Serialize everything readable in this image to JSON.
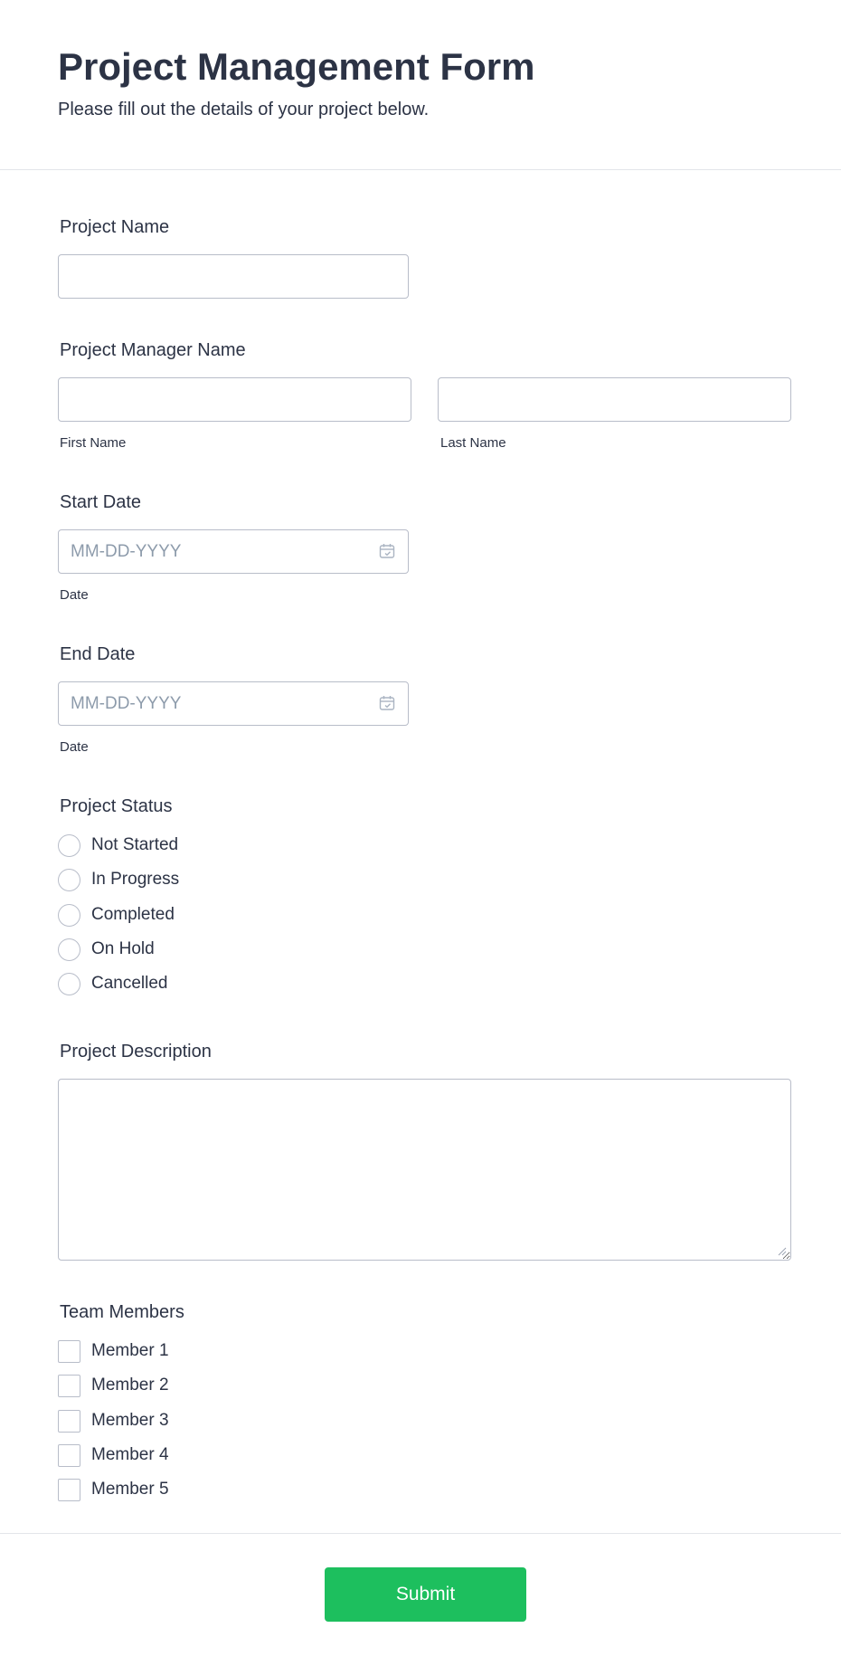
{
  "form": {
    "title": "Project Management Form",
    "subtitle": "Please fill out the details of your project below."
  },
  "project_name": {
    "label": "Project Name",
    "value": ""
  },
  "project_manager": {
    "label": "Project Manager Name",
    "first_name": {
      "value": "",
      "sublabel": "First Name"
    },
    "last_name": {
      "value": "",
      "sublabel": "Last Name"
    }
  },
  "start_date": {
    "label": "Start Date",
    "placeholder": "MM-DD-YYYY",
    "sublabel": "Date",
    "icon": "calendar-icon"
  },
  "end_date": {
    "label": "End Date",
    "placeholder": "MM-DD-YYYY",
    "sublabel": "Date",
    "icon": "calendar-icon"
  },
  "project_status": {
    "label": "Project Status",
    "options": [
      "Not Started",
      "In Progress",
      "Completed",
      "On Hold",
      "Cancelled"
    ],
    "selected": null
  },
  "project_description": {
    "label": "Project Description",
    "value": ""
  },
  "team_members": {
    "label": "Team Members",
    "options": [
      "Member 1",
      "Member 2",
      "Member 3",
      "Member 4",
      "Member 5"
    ],
    "checked": []
  },
  "submit": {
    "label": "Submit"
  },
  "colors": {
    "text": "#2c3345",
    "border": "#b8bdc9",
    "placeholder": "#8d9bab",
    "submit_bg": "#1dbf5e",
    "submit_text": "#ffffff",
    "divider": "#e3e5ea"
  }
}
